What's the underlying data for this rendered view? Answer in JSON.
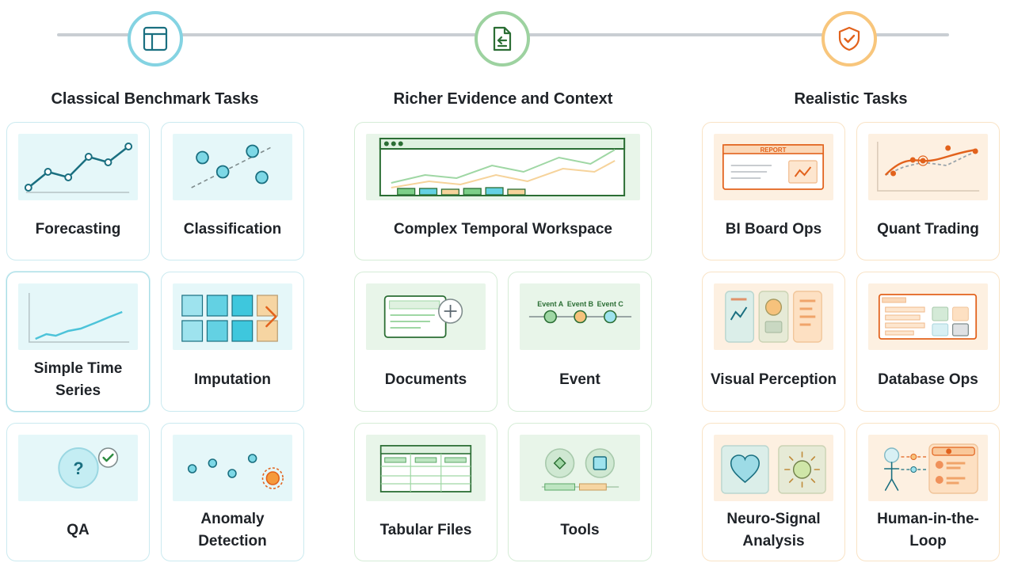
{
  "columns": [
    {
      "title": "Classical Benchmark Tasks",
      "icon": "layout-icon",
      "color": "#84d3e2",
      "cards": [
        {
          "label": "Forecasting"
        },
        {
          "label": "Classification"
        },
        {
          "label": "Simple Time Series"
        },
        {
          "label": "Imputation"
        },
        {
          "label": "QA"
        },
        {
          "label": "Anomaly Detection"
        }
      ]
    },
    {
      "title": "Richer Evidence and Context",
      "icon": "document-icon",
      "color": "#9dd2a0",
      "cards": [
        {
          "label": "Complex Temporal Workspace"
        },
        {
          "label": "Documents"
        },
        {
          "label": "Event"
        },
        {
          "label": "Tabular Files"
        },
        {
          "label": "Tools"
        }
      ]
    },
    {
      "title": "Realistic Tasks",
      "icon": "shield-check-icon",
      "color": "#f8c67c",
      "cards": [
        {
          "label": "BI Board Ops"
        },
        {
          "label": "Quant Trading"
        },
        {
          "label": "Visual Perception"
        },
        {
          "label": "Database Ops"
        },
        {
          "label": "Neuro-Signal Analysis"
        },
        {
          "label": "Human-in-the-Loop"
        }
      ]
    }
  ],
  "thumb_text": {
    "report": "REPORT",
    "event_a": "Event A",
    "event_b": "Event B",
    "event_c": "Event C"
  }
}
